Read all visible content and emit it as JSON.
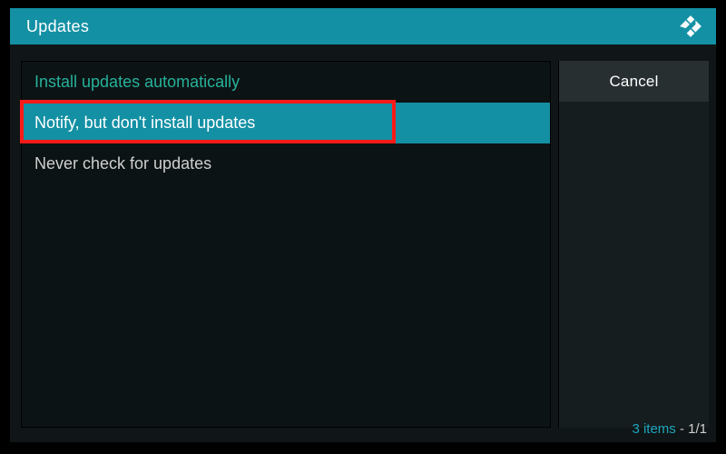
{
  "header": {
    "title": "Updates"
  },
  "options": [
    {
      "label": "Install updates automatically",
      "state": "current"
    },
    {
      "label": "Notify, but don't install updates",
      "state": "selected",
      "highlight": true
    },
    {
      "label": "Never check for updates",
      "state": "plain"
    }
  ],
  "side": {
    "cancel_label": "Cancel"
  },
  "footer": {
    "count_text": "3 items",
    "separator": " - ",
    "page_text": "1/1"
  },
  "colors": {
    "accent": "#1490a4",
    "highlight_border": "#ff1a1a",
    "current_option": "#26b29b"
  }
}
